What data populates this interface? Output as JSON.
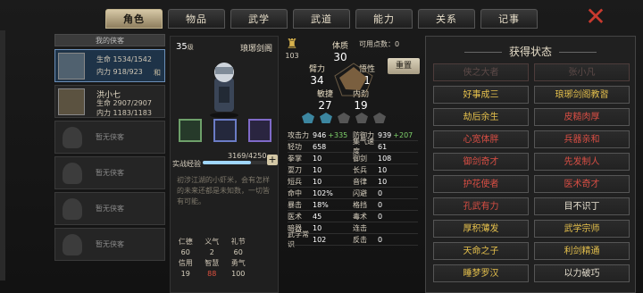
{
  "tabs": [
    {
      "label": "角色"
    },
    {
      "label": "物品"
    },
    {
      "label": "武学"
    },
    {
      "label": "武道"
    },
    {
      "label": "能力"
    },
    {
      "label": "关系"
    },
    {
      "label": "记事"
    }
  ],
  "close_icon": "close-x-icon",
  "roster": {
    "title": "我的侠客",
    "characters": [
      {
        "name": "",
        "hp": "生命 1534/1542",
        "mp": "内力 918/923",
        "side": "和"
      },
      {
        "name": "洪小七",
        "hp": "生命 2907/2907",
        "mp": "内力 1183/1183"
      }
    ],
    "empty_slots": [
      {
        "label": "暂无侠客"
      },
      {
        "label": "暂无侠客"
      },
      {
        "label": "暂无侠客"
      },
      {
        "label": "暂无侠客"
      }
    ]
  },
  "character": {
    "level": "35",
    "level_unit": "级",
    "title": "琅琊剑阁",
    "exp_label": "实战经验",
    "exp_value": "3169/4250",
    "exp_percent": 75,
    "description": "初涉江湖的小虾米，会有怎样的未来还都是未知数，一切皆有可能。",
    "virtues": [
      {
        "label": "仁德",
        "value": "60"
      },
      {
        "label": "义气",
        "value": "2"
      },
      {
        "label": "礼节",
        "value": "60"
      },
      {
        "label": "信用",
        "value": "19"
      },
      {
        "label": "智慧",
        "value": "88",
        "color": "#e0513f"
      },
      {
        "label": "勇气",
        "value": "100"
      }
    ]
  },
  "attributes": {
    "available_points": "可用点数：0",
    "medal_value": "103",
    "reset_label": "重置",
    "items": [
      {
        "label": "体质",
        "value": "30"
      },
      {
        "label": "悟性",
        "value": "1"
      },
      {
        "label": "内劲",
        "value": "19"
      },
      {
        "label": "敏捷",
        "value": "27"
      },
      {
        "label": "臂力",
        "value": "34"
      }
    ]
  },
  "combat_stats": [
    [
      {
        "label": "攻击力",
        "value": "946",
        "bonus": "+335"
      },
      {
        "label": "防御力",
        "value": "939",
        "bonus": "+207"
      }
    ],
    [
      {
        "label": "轻功",
        "value": "658"
      },
      {
        "label": "集气速度",
        "value": "61"
      }
    ],
    [
      {
        "label": "拳掌",
        "value": "10"
      },
      {
        "label": "御剑",
        "value": "108"
      }
    ],
    [
      {
        "label": "耍刀",
        "value": "10"
      },
      {
        "label": "长兵",
        "value": "10"
      }
    ],
    [
      {
        "label": "短兵",
        "value": "10"
      },
      {
        "label": "音律",
        "value": "10"
      }
    ],
    [
      {
        "label": "命中",
        "value": "102%"
      },
      {
        "label": "闪避",
        "value": "0"
      }
    ],
    [
      {
        "label": "暴击",
        "value": "18%"
      },
      {
        "label": "格挡",
        "value": "0"
      }
    ],
    [
      {
        "label": "医术",
        "value": "45"
      },
      {
        "label": "毒术",
        "value": "0"
      }
    ],
    [
      {
        "label": "暗器",
        "value": "10"
      },
      {
        "label": "连击",
        "value": ""
      }
    ],
    [
      {
        "label": "武学常识",
        "value": "102"
      },
      {
        "label": "反击",
        "value": "0"
      }
    ]
  ],
  "states": {
    "title": "获得状态",
    "items": [
      {
        "label": "侠之大者",
        "state": "locked"
      },
      {
        "label": "张小凡",
        "state": "locked"
      },
      {
        "label": "好事成三",
        "state": "yellow"
      },
      {
        "label": "琅琊剑阁教習",
        "state": "yellow"
      },
      {
        "label": "劫后余生",
        "state": "yellow"
      },
      {
        "label": "皮糙肉厚",
        "state": "open"
      },
      {
        "label": "心宽体胖",
        "state": "open"
      },
      {
        "label": "兵器亲和",
        "state": "open"
      },
      {
        "label": "御剑奇才",
        "state": "open"
      },
      {
        "label": "先发制人",
        "state": "open"
      },
      {
        "label": "护花使者",
        "state": "open"
      },
      {
        "label": "医术奇才",
        "state": "open"
      },
      {
        "label": "孔武有力",
        "state": "open"
      },
      {
        "label": "目不识丁",
        "state": "white"
      },
      {
        "label": "厚积薄发",
        "state": "yellow"
      },
      {
        "label": "武学宗师",
        "state": "yellow"
      },
      {
        "label": "天命之子",
        "state": "yellow"
      },
      {
        "label": "利剑精通",
        "state": "yellow"
      },
      {
        "label": "睡梦罗汉",
        "state": "yellow"
      },
      {
        "label": "以力破巧",
        "state": "white"
      }
    ]
  },
  "colors": {
    "accent": "#d6c8a6",
    "danger": "#c83a2f",
    "bonus": "#7fd36b",
    "red_state": "#d94e44",
    "yellow_state": "#e5c04c"
  }
}
